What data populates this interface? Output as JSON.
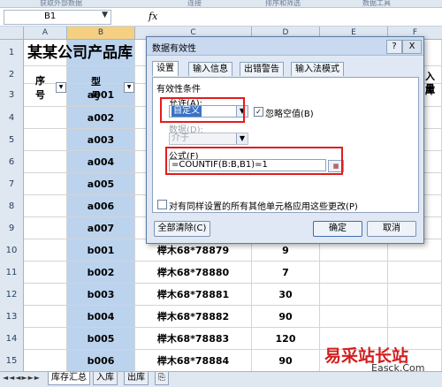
{
  "ribbon": {
    "groups": [
      "获取外部数据",
      "连接",
      "排序和筛选",
      "数据工具"
    ]
  },
  "formula_bar": {
    "name_box": "B1",
    "fx": "fx"
  },
  "columns": [
    "A",
    "B",
    "C",
    "D",
    "E",
    "F"
  ],
  "rows": [
    {
      "n": "1",
      "b": "",
      "c": "",
      "d": ""
    },
    {
      "n": "2",
      "b": "",
      "c": "",
      "d": ""
    },
    {
      "n": "3",
      "b": "a001",
      "c": "",
      "d": ""
    },
    {
      "n": "4",
      "b": "a002",
      "c": "",
      "d": ""
    },
    {
      "n": "5",
      "b": "a003",
      "c": "",
      "d": ""
    },
    {
      "n": "6",
      "b": "a004",
      "c": "",
      "d": ""
    },
    {
      "n": "7",
      "b": "a005",
      "c": "",
      "d": ""
    },
    {
      "n": "8",
      "b": "a006",
      "c": "",
      "d": ""
    },
    {
      "n": "9",
      "b": "a007",
      "c": "",
      "d": ""
    },
    {
      "n": "10",
      "b": "b001",
      "c": "榉木68*78879",
      "d": "9"
    },
    {
      "n": "11",
      "b": "b002",
      "c": "榉木68*78880",
      "d": "7"
    },
    {
      "n": "12",
      "b": "b003",
      "c": "榉木68*78881",
      "d": "30"
    },
    {
      "n": "13",
      "b": "b004",
      "c": "榉木68*78882",
      "d": "90"
    },
    {
      "n": "14",
      "b": "b005",
      "c": "榉木68*78883",
      "d": "120"
    },
    {
      "n": "15",
      "b": "b006",
      "c": "榉木68*78884",
      "d": "90"
    }
  ],
  "sheet_title": "某某公司产品库",
  "headers": {
    "a": "序号",
    "b": "型号",
    "f_partial_1": "入库",
    "f_partial_2": "量"
  },
  "sheet_tabs": [
    "库存汇总",
    "入库",
    "出库"
  ],
  "dialog": {
    "title": "数据有效性",
    "help": "?",
    "close": "X",
    "tabs": [
      "设置",
      "输入信息",
      "出错警告",
      "输入法模式"
    ],
    "section": "有效性条件",
    "allow_label": "允许(A):",
    "allow_value": "自定义",
    "ignore_blank": "忽略空值(B)",
    "data_label": "数据(D):",
    "data_value": "介于",
    "formula_label": "公式(F)",
    "formula_value": "=COUNTIF(B:B,B1)=1",
    "apply_all": "对有同样设置的所有其他单元格应用这些更改(P)",
    "clear_all": "全部清除(C)",
    "ok": "确定",
    "cancel": "取消"
  },
  "watermark": {
    "text": "易采站长站",
    "sub": "Easck.Com"
  }
}
